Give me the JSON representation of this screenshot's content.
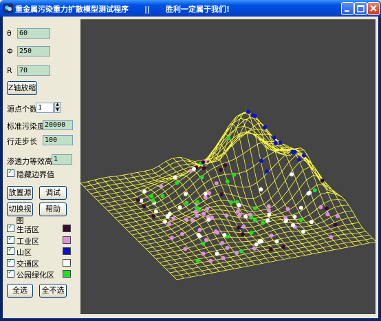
{
  "window": {
    "title": "重金属污染重力扩散模型测试程序      ||      胜利一定属于我们!"
  },
  "params": [
    {
      "symbol": "θ",
      "value": "60"
    },
    {
      "symbol": "Φ",
      "value": "250"
    },
    {
      "symbol": "R",
      "value": "70"
    }
  ],
  "buttons": {
    "z_zoom": "Z轴放缩",
    "place_source": "放置源",
    "debug": "调试",
    "switch_view": "切换视图",
    "help": "帮助",
    "select_all": "全选",
    "select_none": "全不选"
  },
  "source_count": {
    "label": "源点个数",
    "value": "1"
  },
  "std_pollution": {
    "label": "标准污染度",
    "value": "20000"
  },
  "step": {
    "label": "行走步长",
    "value": "100"
  },
  "seep": {
    "label": "渗透力等效高度",
    "value": "1"
  },
  "hide_boundary": {
    "label": "隐藏边界值"
  },
  "zones": [
    {
      "label": "生活区",
      "color": "#3a0a30"
    },
    {
      "label": "工业区",
      "color": "#e090e0"
    },
    {
      "label": "山区",
      "color": "#1010d0"
    },
    {
      "label": "交通区",
      "color": "#ffffff"
    },
    {
      "label": "公园绿化区",
      "color": "#20e020"
    }
  ],
  "plot": {
    "background": "#454545",
    "mesh_color": "#ffff40"
  }
}
